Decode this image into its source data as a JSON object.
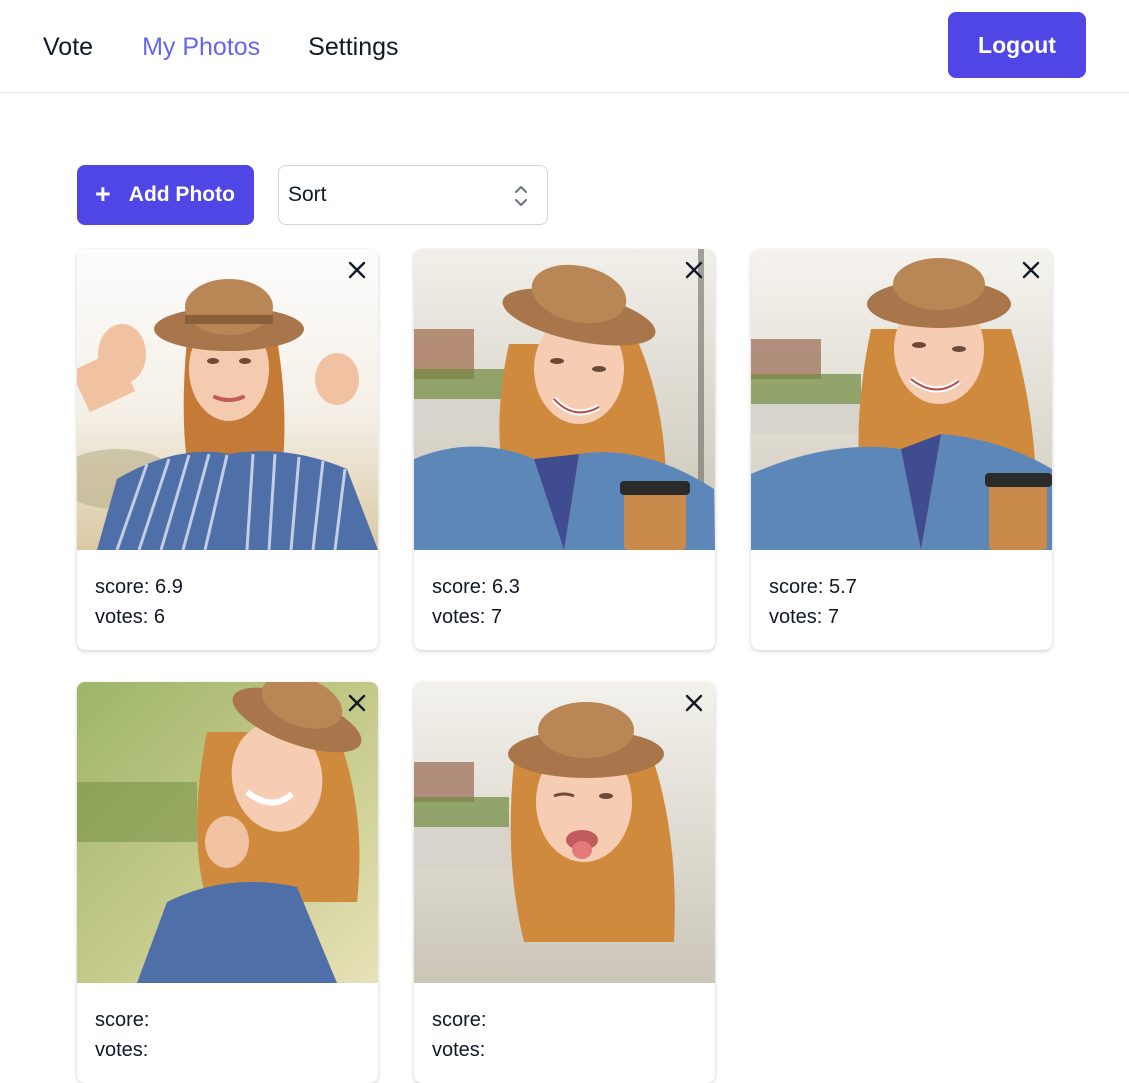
{
  "nav": {
    "vote": "Vote",
    "my_photos": "My Photos",
    "settings": "Settings",
    "active": "My Photos"
  },
  "header": {
    "logout_label": "Logout"
  },
  "toolbar": {
    "add_photo_icon": "plus-icon",
    "add_photo_label": "Add Photo",
    "sort_value": "Sort",
    "sort_icon": "chevron-up-down-icon"
  },
  "colors": {
    "accent": "#4f46e5",
    "nav_active": "#6366f1",
    "text": "#111827"
  },
  "photos": [
    {
      "score_label": "score:",
      "score": "6.9",
      "votes_label": "votes:",
      "votes": "6"
    },
    {
      "score_label": "score:",
      "score": "6.3",
      "votes_label": "votes:",
      "votes": "7"
    },
    {
      "score_label": "score:",
      "score": "5.7",
      "votes_label": "votes:",
      "votes": "7"
    },
    {
      "score_label": "score:",
      "score": "",
      "votes_label": "votes:",
      "votes": ""
    },
    {
      "score_label": "score:",
      "score": "",
      "votes_label": "votes:",
      "votes": ""
    }
  ],
  "card_close_icon": "close-icon"
}
